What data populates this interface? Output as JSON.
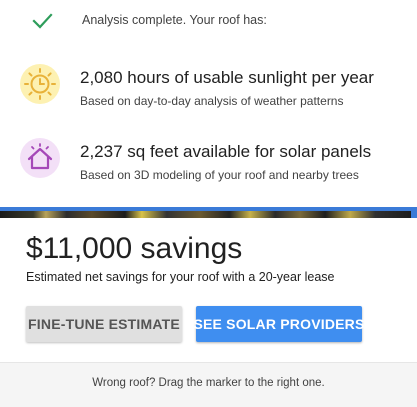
{
  "status": {
    "icon": "check-icon",
    "color": "#2e9d5b",
    "text": "Analysis complete. Your roof has:"
  },
  "features": [
    {
      "icon": "sun-icon",
      "icon_bg": "#fdf1b2",
      "icon_color": "#e8b23a",
      "title": "2,080 hours of usable sunlight per year",
      "subtitle": "Based on day-to-day analysis of weather patterns"
    },
    {
      "icon": "house-icon",
      "icon_bg": "#f3e0f7",
      "icon_color": "#a548b8",
      "title": "2,237 sq feet available for solar panels",
      "subtitle": "Based on 3D modeling of your roof and nearby trees"
    }
  ],
  "savings": {
    "amount": "$11,000 savings",
    "subtitle": "Estimated net savings for your roof with a 20-year lease"
  },
  "buttons": {
    "fine_tune": "FINE-TUNE ESTIMATE",
    "providers": "SEE SOLAR PROVIDERS"
  },
  "footer": {
    "text": "Wrong roof? Drag the marker to the right one."
  },
  "colors": {
    "accent_blue": "#3f8ef0",
    "divider_blue": "#3b7bd8"
  }
}
